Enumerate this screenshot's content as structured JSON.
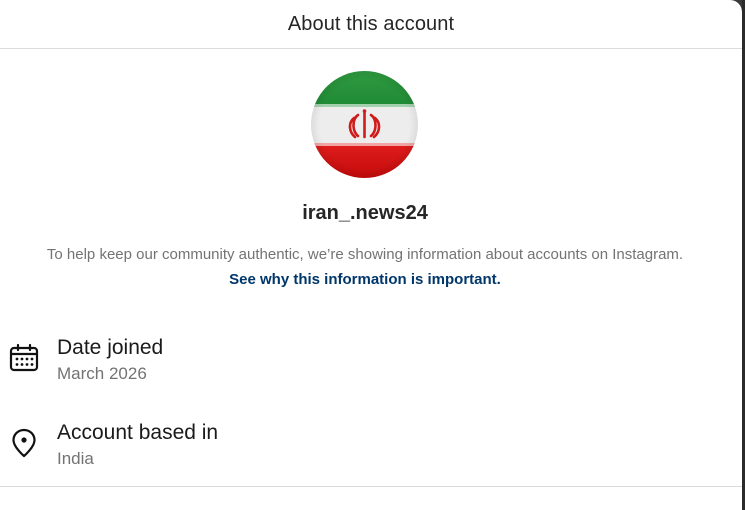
{
  "dialog": {
    "title": "About this account"
  },
  "profile": {
    "username": "iran_.news24",
    "avatar_icon": "iran-flag-avatar",
    "colors": {
      "flag_green": "#239f40",
      "flag_white": "#f2f2f2",
      "flag_red": "#da0000"
    }
  },
  "info": {
    "text": "To help keep our community authentic, we’re showing information about accounts on Instagram. ",
    "link_label": "See why this information is important."
  },
  "details": {
    "date_joined": {
      "icon": "calendar-icon",
      "title": "Date joined",
      "value": "March 2026"
    },
    "account_based_in": {
      "icon": "location-pin-icon",
      "title": "Account based in",
      "value": "India"
    }
  },
  "colors": {
    "link": "#00376b",
    "secondary_text": "#737373",
    "primary_text": "#262626",
    "divider": "#dbdbdb"
  }
}
